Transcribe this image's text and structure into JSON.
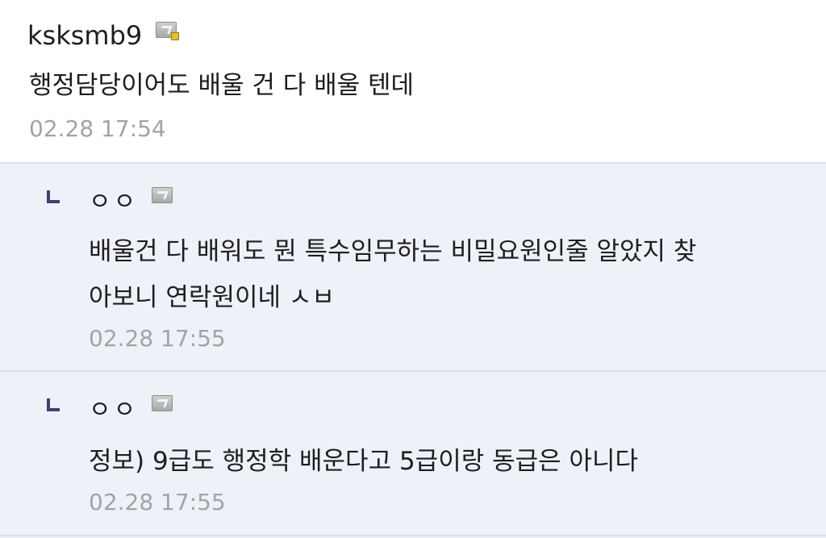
{
  "comments": [
    {
      "nickname": "ksksmb9",
      "badge_icon": "level-badge-icon",
      "lines": [
        "행정담당이어도 배울 건 다 배울 텐데"
      ],
      "time": "02.28 17:54"
    },
    {
      "nickname": "ㅇㅇ",
      "badge_icon": "level-badge-icon",
      "lines": [
        "배울건 다 배워도 뭔 특수임무하는 비밀요원인줄 알았지 찾",
        "아보니 연락원이네 ㅅㅂ"
      ],
      "time": "02.28 17:55"
    },
    {
      "nickname": "ㅇㅇ",
      "badge_icon": "level-badge-icon",
      "lines": [
        "정보) 9급도 행정학 배운다고 5급이랑 동급은 아니다"
      ],
      "time": "02.28 17:55"
    }
  ],
  "colors": {
    "reply_background": "#eef1f8",
    "timestamp": "#a3a3a3",
    "reply_arrow": "#3a4370"
  }
}
